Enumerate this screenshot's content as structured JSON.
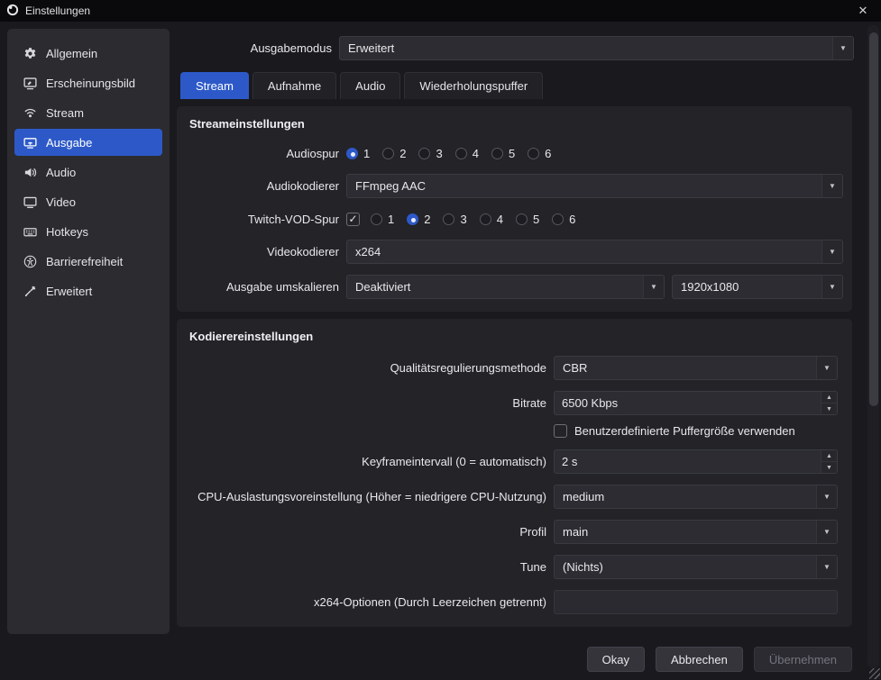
{
  "window": {
    "title": "Einstellungen"
  },
  "icons": {
    "close": "✕",
    "dropdown_arrow": "▼",
    "spin_up": "▲",
    "spin_down": "▼",
    "check": "✓"
  },
  "colors": {
    "accent_blue": "#2d59c8",
    "titlebar_bg": "#0a0a0c",
    "window_bg": "#1a1a1e",
    "sidebar_bg": "#2b2b30",
    "group_bg": "#232328",
    "control_bg": "#2c2c32",
    "text": "#e9e9ec",
    "disabled_text": "#74747d"
  },
  "sidebar": {
    "items": [
      {
        "label": "Allgemein",
        "active": false
      },
      {
        "label": "Erscheinungsbild",
        "active": false
      },
      {
        "label": "Stream",
        "active": false
      },
      {
        "label": "Ausgabe",
        "active": true
      },
      {
        "label": "Audio",
        "active": false
      },
      {
        "label": "Video",
        "active": false
      },
      {
        "label": "Hotkeys",
        "active": false
      },
      {
        "label": "Barrierefreiheit",
        "active": false
      },
      {
        "label": "Erweitert",
        "active": false
      }
    ]
  },
  "output_mode": {
    "label": "Ausgabemodus",
    "value": "Erweitert"
  },
  "tabs": [
    {
      "label": "Stream",
      "active": true
    },
    {
      "label": "Aufnahme",
      "active": false
    },
    {
      "label": "Audio",
      "active": false
    },
    {
      "label": "Wiederholungspuffer",
      "active": false
    }
  ],
  "stream_settings": {
    "title": "Streameinstellungen",
    "audio_track": {
      "label": "Audiospur",
      "options": [
        {
          "label": "1",
          "selected": true
        },
        {
          "label": "2",
          "selected": false
        },
        {
          "label": "3",
          "selected": false
        },
        {
          "label": "4",
          "selected": false
        },
        {
          "label": "5",
          "selected": false
        },
        {
          "label": "6",
          "selected": false
        }
      ]
    },
    "audio_encoder": {
      "label": "Audiokodierer",
      "value": "FFmpeg AAC"
    },
    "vod_track": {
      "label": "Twitch-VOD-Spur",
      "enabled": true,
      "options": [
        {
          "label": "1",
          "selected": false
        },
        {
          "label": "2",
          "selected": true
        },
        {
          "label": "3",
          "selected": false
        },
        {
          "label": "4",
          "selected": false
        },
        {
          "label": "5",
          "selected": false
        },
        {
          "label": "6",
          "selected": false
        }
      ]
    },
    "video_encoder": {
      "label": "Videokodierer",
      "value": "x264"
    },
    "rescale": {
      "label": "Ausgabe umskalieren",
      "mode": "Deaktiviert",
      "resolution": "1920x1080"
    }
  },
  "encoder_settings": {
    "title": "Kodierereinstellungen",
    "rate_control": {
      "label": "Qualitätsregulierungsmethode",
      "value": "CBR"
    },
    "bitrate": {
      "label": "Bitrate",
      "value": "6500 Kbps"
    },
    "custom_buffer": {
      "label": "Benutzerdefinierte Puffergröße verwenden",
      "checked": false
    },
    "keyframe_interval": {
      "label": "Keyframeintervall (0 = automatisch)",
      "value": "2 s"
    },
    "cpu_preset": {
      "label": "CPU-Auslastungsvoreinstellung (Höher = niedrigere CPU-Nutzung)",
      "value": "medium"
    },
    "profile": {
      "label": "Profil",
      "value": "main"
    },
    "tune": {
      "label": "Tune",
      "value": "(Nichts)"
    },
    "x264_options": {
      "label": "x264-Optionen (Durch Leerzeichen getrennt)",
      "value": ""
    }
  },
  "footer": {
    "buttons": [
      {
        "label": "Okay",
        "disabled": false
      },
      {
        "label": "Abbrechen",
        "disabled": false
      },
      {
        "label": "Übernehmen",
        "disabled": true
      }
    ]
  }
}
